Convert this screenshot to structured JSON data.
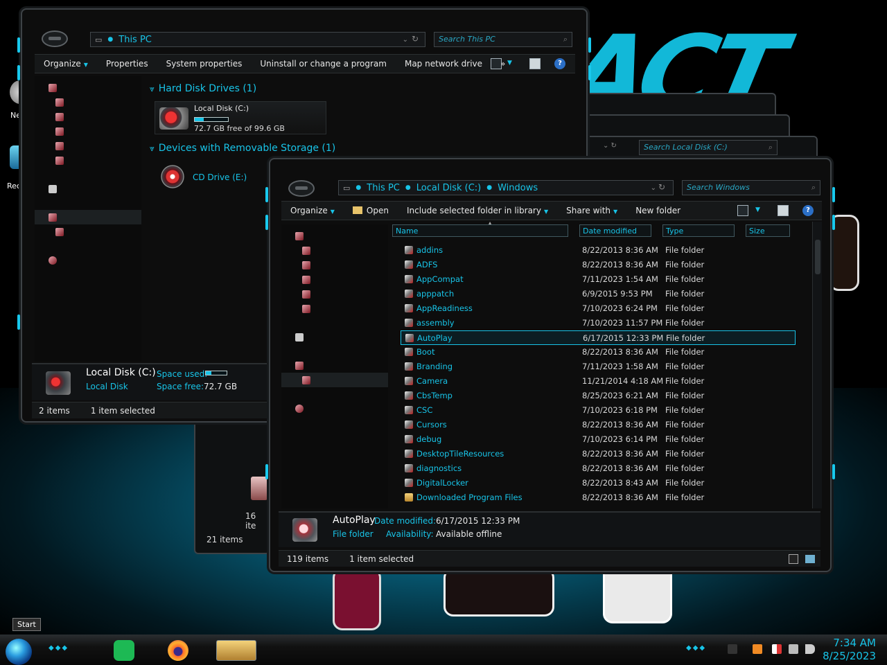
{
  "desktop": {
    "icon_labels": [
      "Ne",
      "Rec"
    ]
  },
  "win1": {
    "address": "This PC",
    "search_placeholder": "Search This PC",
    "toolbar": [
      "Organize",
      "Properties",
      "System properties",
      "Uninstall or change a program",
      "Map network drive"
    ],
    "more": "»",
    "group_hdd": "Hard Disk Drives (1)",
    "group_removable": "Devices with Removable Storage (1)",
    "disk_name": "Local Disk (C:)",
    "disk_free": "72.7 GB free of 99.6 GB",
    "disk_used_fraction": 0.27,
    "cd_name": "CD Drive (E:)",
    "details": {
      "name": "Local Disk (C:)",
      "type": "Local Disk",
      "used_label": "Space used:",
      "free_label": "Space free:",
      "free_value": "72.7 GB"
    },
    "status_items": "2 items",
    "status_selected": "1 item selected"
  },
  "back_windows": {
    "search_placeholder": "Search Local Disk (C:)",
    "status_a": "21 items",
    "status_b": "16 ite"
  },
  "win2": {
    "breadcrumb": [
      "This PC",
      "Local Disk (C:)",
      "Windows"
    ],
    "search_placeholder": "Search Windows",
    "toolbar": {
      "organize": "Organize",
      "open": "Open",
      "include": "Include selected folder in library",
      "share": "Share with",
      "new_folder": "New folder"
    },
    "columns": [
      "Name",
      "Date modified",
      "Type",
      "Size"
    ],
    "files": [
      {
        "name": "addins",
        "date": "8/22/2013 8:36 AM",
        "type": "File folder"
      },
      {
        "name": "ADFS",
        "date": "8/22/2013 8:36 AM",
        "type": "File folder"
      },
      {
        "name": "AppCompat",
        "date": "7/11/2023 1:54 AM",
        "type": "File folder"
      },
      {
        "name": "apppatch",
        "date": "6/9/2015 9:53 PM",
        "type": "File folder"
      },
      {
        "name": "AppReadiness",
        "date": "7/10/2023 6:24 PM",
        "type": "File folder"
      },
      {
        "name": "assembly",
        "date": "7/10/2023 11:57 PM",
        "type": "File folder"
      },
      {
        "name": "AutoPlay",
        "date": "6/17/2015 12:33 PM",
        "type": "File folder"
      },
      {
        "name": "Boot",
        "date": "8/22/2013 8:36 AM",
        "type": "File folder"
      },
      {
        "name": "Branding",
        "date": "7/11/2023 1:58 AM",
        "type": "File folder"
      },
      {
        "name": "Camera",
        "date": "11/21/2014 4:18 AM",
        "type": "File folder"
      },
      {
        "name": "CbsTemp",
        "date": "8/25/2023 6:21 AM",
        "type": "File folder"
      },
      {
        "name": "CSC",
        "date": "7/10/2023 6:18 PM",
        "type": "File folder"
      },
      {
        "name": "Cursors",
        "date": "8/22/2013 8:36 AM",
        "type": "File folder"
      },
      {
        "name": "debug",
        "date": "7/10/2023 6:14 PM",
        "type": "File folder"
      },
      {
        "name": "DesktopTileResources",
        "date": "8/22/2013 8:36 AM",
        "type": "File folder"
      },
      {
        "name": "diagnostics",
        "date": "8/22/2013 8:36 AM",
        "type": "File folder"
      },
      {
        "name": "DigitalLocker",
        "date": "8/22/2013 8:43 AM",
        "type": "File folder"
      },
      {
        "name": "Downloaded Program Files",
        "date": "8/22/2013 8:36 AM",
        "type": "File folder"
      }
    ],
    "selected_index": 6,
    "details": {
      "name": "AutoPlay",
      "type": "File folder",
      "date_label": "Date modified:",
      "date_value": "6/17/2015 12:33 PM",
      "avail_label": "Availability:",
      "avail_value": "Available offline"
    },
    "status_items": "119 items",
    "status_selected": "1 item selected"
  },
  "taskbar": {
    "start_tooltip": "Start",
    "time": "7:34 AM",
    "date": "8/25/2023"
  },
  "colors": {
    "accent": "#18c4e8",
    "window_bg": "#0d0d0d",
    "selection": "#0c1d22"
  }
}
